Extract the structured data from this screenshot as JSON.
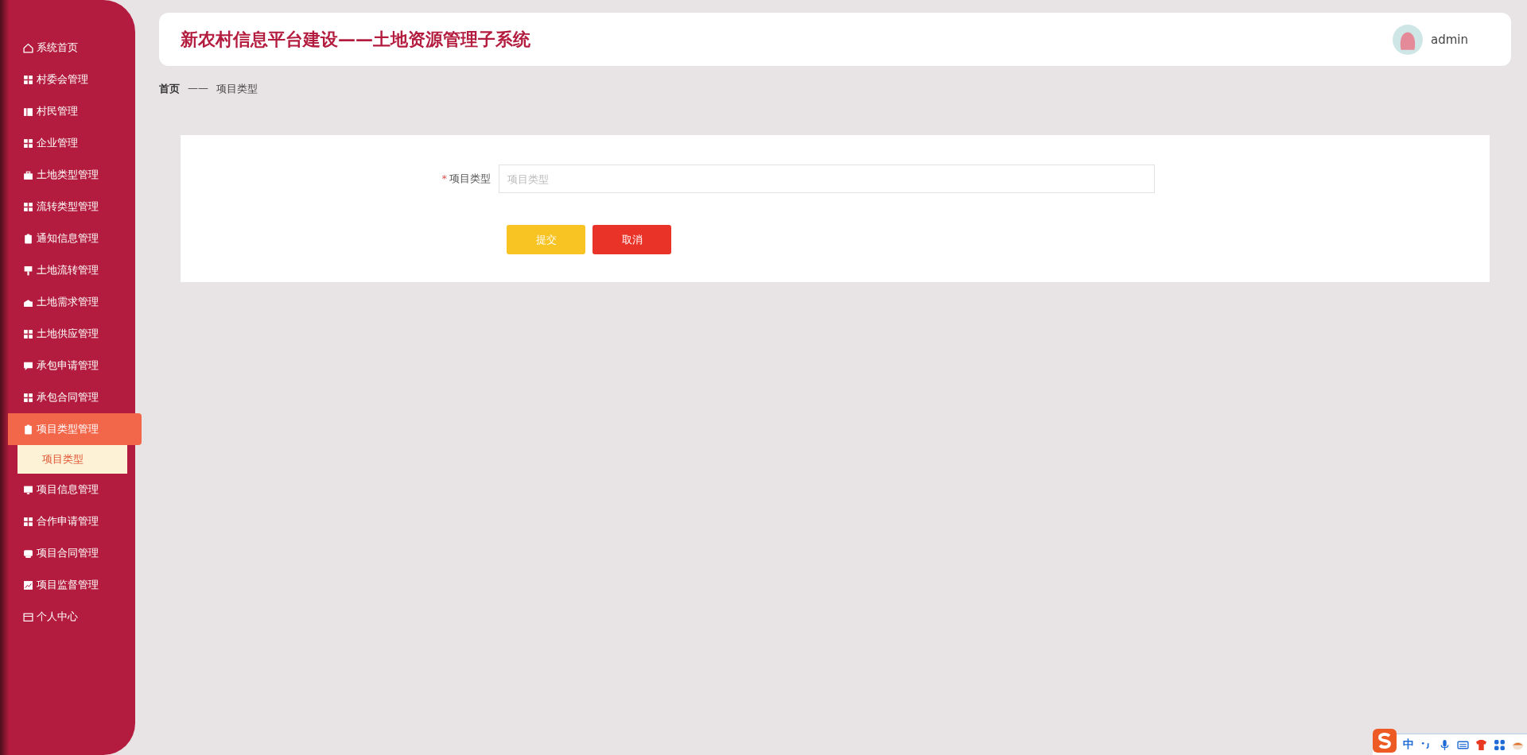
{
  "sidebar": {
    "items": [
      {
        "label": "系统首页",
        "selected": false
      },
      {
        "label": "村委会管理",
        "selected": false
      },
      {
        "label": "村民管理",
        "selected": false
      },
      {
        "label": "企业管理",
        "selected": false
      },
      {
        "label": "土地类型管理",
        "selected": false
      },
      {
        "label": "流转类型管理",
        "selected": false
      },
      {
        "label": "通知信息管理",
        "selected": false
      },
      {
        "label": "土地流转管理",
        "selected": false
      },
      {
        "label": "土地需求管理",
        "selected": false
      },
      {
        "label": "土地供应管理",
        "selected": false
      },
      {
        "label": "承包申请管理",
        "selected": false
      },
      {
        "label": "承包合同管理",
        "selected": false
      },
      {
        "label": "项目类型管理",
        "selected": true,
        "children": [
          {
            "label": "项目类型",
            "selected": true
          }
        ]
      },
      {
        "label": "项目信息管理",
        "selected": false
      },
      {
        "label": "合作申请管理",
        "selected": false
      },
      {
        "label": "项目合同管理",
        "selected": false
      },
      {
        "label": "项目监督管理",
        "selected": false
      },
      {
        "label": "个人中心",
        "selected": false
      }
    ]
  },
  "header": {
    "title": "新农村信息平台建设——土地资源管理子系统",
    "user": "admin"
  },
  "breadcrumb": [
    "首页",
    "——",
    "项目类型"
  ],
  "form": {
    "fields": [
      {
        "label": "项目类型",
        "required_mark": "*",
        "placeholder": "项目类型"
      }
    ],
    "buttons": [
      {
        "label": "提交",
        "kind": "submit"
      },
      {
        "label": "取消",
        "kind": "cancel"
      }
    ]
  },
  "ime_toolbar": {
    "mode": "中"
  }
}
